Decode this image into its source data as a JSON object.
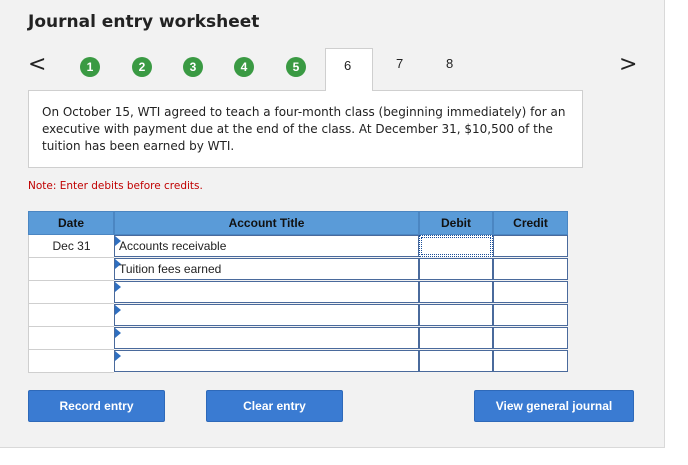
{
  "title": "Journal entry worksheet",
  "nav": {
    "prev": "<",
    "next": ">",
    "completed_steps": [
      "1",
      "2",
      "3",
      "4",
      "5"
    ],
    "active_step": "6",
    "other_steps": [
      "7",
      "8"
    ],
    "step_color": "#3a9a43"
  },
  "question": "On October 15, WTI agreed to teach a four-month class (beginning immediately) for an executive with payment due at the end of the class. At December 31, $10,500 of the tuition has been earned by WTI.",
  "note": "Note: Enter debits before credits.",
  "table": {
    "headers": {
      "date": "Date",
      "account": "Account Title",
      "debit": "Debit",
      "credit": "Credit"
    },
    "rows": [
      {
        "date": "Dec 31",
        "account": "Accounts receivable",
        "debit": "",
        "credit": ""
      },
      {
        "date": "",
        "account": "Tuition fees earned",
        "debit": "",
        "credit": ""
      },
      {
        "date": "",
        "account": "",
        "debit": "",
        "credit": ""
      },
      {
        "date": "",
        "account": "",
        "debit": "",
        "credit": ""
      },
      {
        "date": "",
        "account": "",
        "debit": "",
        "credit": ""
      },
      {
        "date": "",
        "account": "",
        "debit": "",
        "credit": ""
      }
    ]
  },
  "buttons": {
    "record": "Record entry",
    "clear": "Clear entry",
    "view": "View general journal"
  },
  "colors": {
    "header_bg": "#5a9bd8",
    "button_bg": "#3a7bd2",
    "note": "#c00000"
  }
}
